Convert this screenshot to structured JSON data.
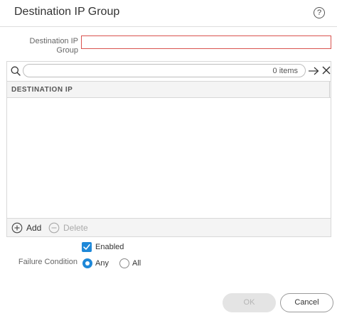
{
  "dialog": {
    "title": "Destination IP Group",
    "help_icon": "question-circle-icon",
    "help_glyph": "?"
  },
  "form": {
    "group_label": "Destination IP Group",
    "group_value": "",
    "group_placeholder": ""
  },
  "grid": {
    "search_value": "",
    "item_count": "0 items",
    "column_header": "DESTINATION IP",
    "rows": [],
    "add_label": "Add",
    "delete_label": "Delete"
  },
  "options": {
    "enabled_label": "Enabled",
    "enabled_checked": true,
    "failure_condition_label": "Failure Condition",
    "any_label": "Any",
    "all_label": "All",
    "selected": "Any"
  },
  "footer": {
    "ok_label": "OK",
    "cancel_label": "Cancel"
  },
  "colors": {
    "accent": "#1e88d8",
    "error_border": "#d9534f"
  }
}
